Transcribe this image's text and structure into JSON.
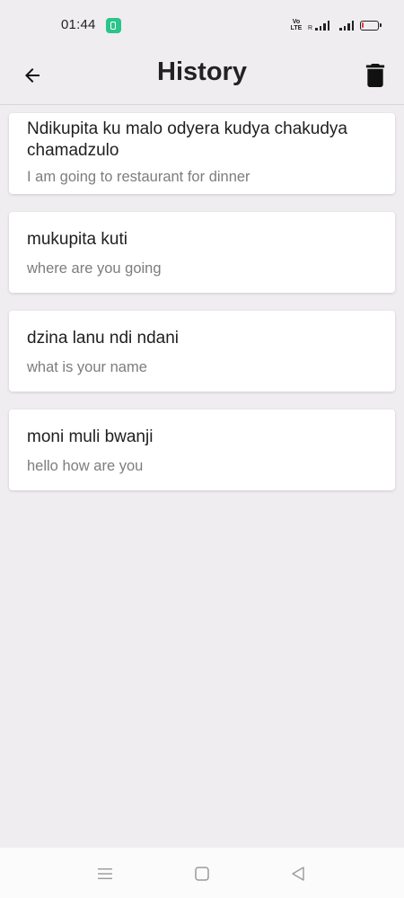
{
  "status_bar": {
    "time": "01:44",
    "network_label": "VoLTE",
    "roaming_label": "R",
    "battery_color": "#e53935",
    "battery_level": 0.15
  },
  "header": {
    "title": "History",
    "back_icon": "arrow-left-icon",
    "delete_icon": "trash-icon"
  },
  "history": [
    {
      "source": "Ndikupita ku malo odyera kudya chakudya chamadzulo",
      "target": "I am going to restaurant for dinner"
    },
    {
      "source": "mukupita kuti",
      "target": "where are you going"
    },
    {
      "source": "dzina lanu ndi ndani",
      "target": "what is your name"
    },
    {
      "source": "moni muli bwanji",
      "target": "hello how are you"
    }
  ],
  "nav_bar": {
    "menu_icon": "menu-icon",
    "home_icon": "square-home-icon",
    "back_icon": "triangle-back-icon"
  }
}
